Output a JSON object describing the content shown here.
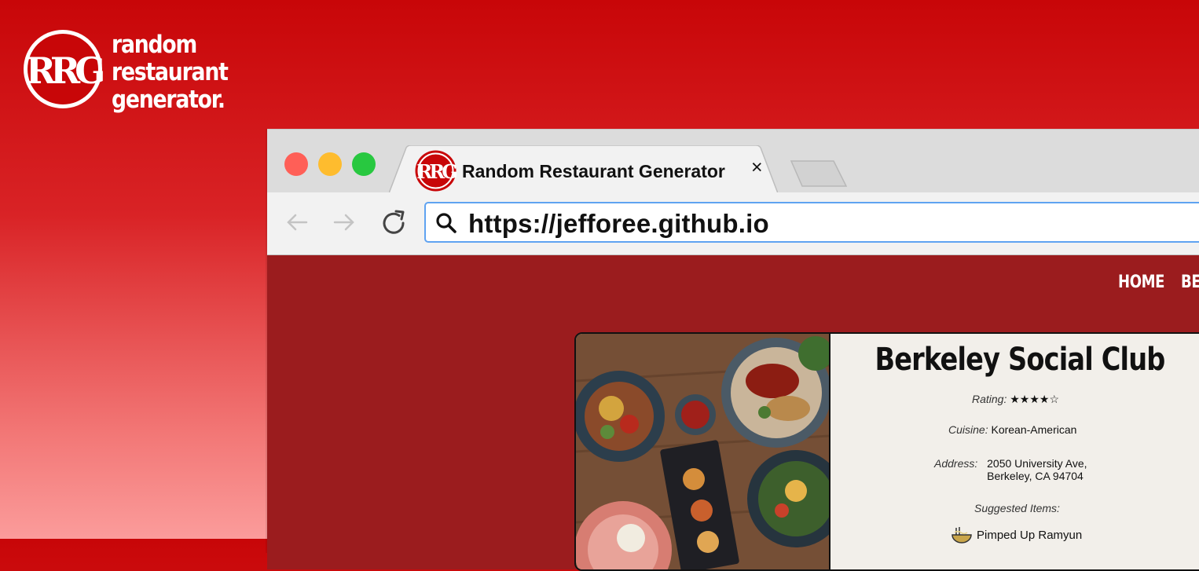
{
  "brand": {
    "logo_text": "RRG",
    "lines": [
      "random",
      "restaurant",
      "generator."
    ]
  },
  "browser": {
    "tab_title": "Random Restaurant Generator",
    "tab_close": "×",
    "url": "https://jefforee.github.io",
    "traffic_lights": {
      "close": "#ff5f57",
      "minimize": "#febc2e",
      "maximize": "#28c840"
    }
  },
  "site": {
    "nav": [
      "HOME",
      "BE"
    ],
    "restaurant": {
      "name": "Berkeley Social Club",
      "rating_label": "Rating:",
      "rating_value": "★★★★☆",
      "cuisine_label": "Cuisine:",
      "cuisine_value": "Korean-American",
      "address_label": "Address:",
      "address_line1": "2050 University Ave,",
      "address_line2": "Berkeley, CA 94704",
      "suggested_label": "Suggested Items:",
      "items": [
        "Pimped Up Ramyun"
      ]
    }
  },
  "colors": {
    "brand_red": "#c80608",
    "page_red": "#9b1c1e",
    "url_focus": "#5fa3f1"
  },
  "icons": [
    "rrg-logo-icon",
    "back-arrow-icon",
    "forward-arrow-icon",
    "reload-icon",
    "search-icon",
    "noodle-bowl-icon"
  ]
}
